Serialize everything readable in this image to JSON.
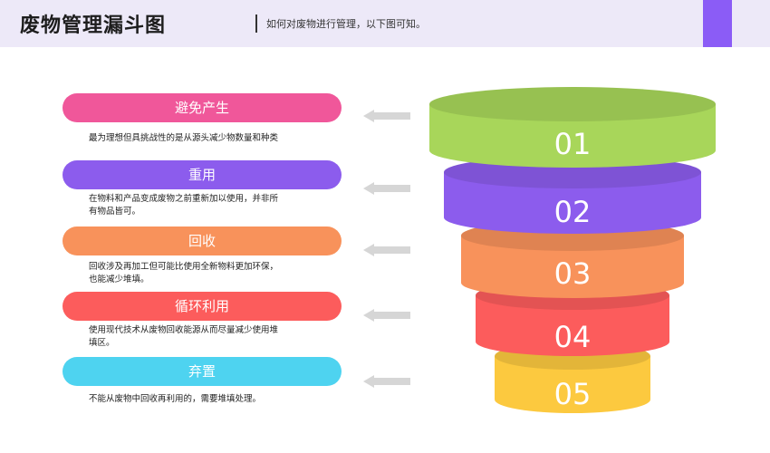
{
  "header": {
    "title": "废物管理漏斗图",
    "subtitle": "如何对废物进行管理，以下图可知。",
    "accent_color": "#8b5cf6"
  },
  "steps": [
    {
      "label": "避免产生",
      "number": "01",
      "description": [
        "最为理想但具挑战性的是从源头减少物数量和种类"
      ],
      "color": "#f0579a"
    },
    {
      "label": "重用",
      "number": "02",
      "description": [
        "在物料和产品变成废物之前重新加以使用，并非所",
        "有物品皆可。"
      ],
      "color": "#8c5ced"
    },
    {
      "label": "回收",
      "number": "03",
      "description": [
        "回收涉及再加工但可能比使用全新物料更加环保，",
        "也能减少堆填。"
      ],
      "color": "#f8925b"
    },
    {
      "label": "循环利用",
      "number": "04",
      "description": [
        "使用现代技术从废物回收能源从而尽量减少使用堆",
        "填区。"
      ],
      "color": "#fc5c5c"
    },
    {
      "label": "弃置",
      "number": "05",
      "description": [
        "不能从废物中回收再利用的，需要堆填处理。"
      ],
      "color": "#4ed3f0"
    }
  ],
  "funnel_colors": [
    "#a8d65a",
    "#8c5ced",
    "#f8925b",
    "#fc5c5c",
    "#fcc93f"
  ],
  "arrow_color": "#d6d6d6"
}
